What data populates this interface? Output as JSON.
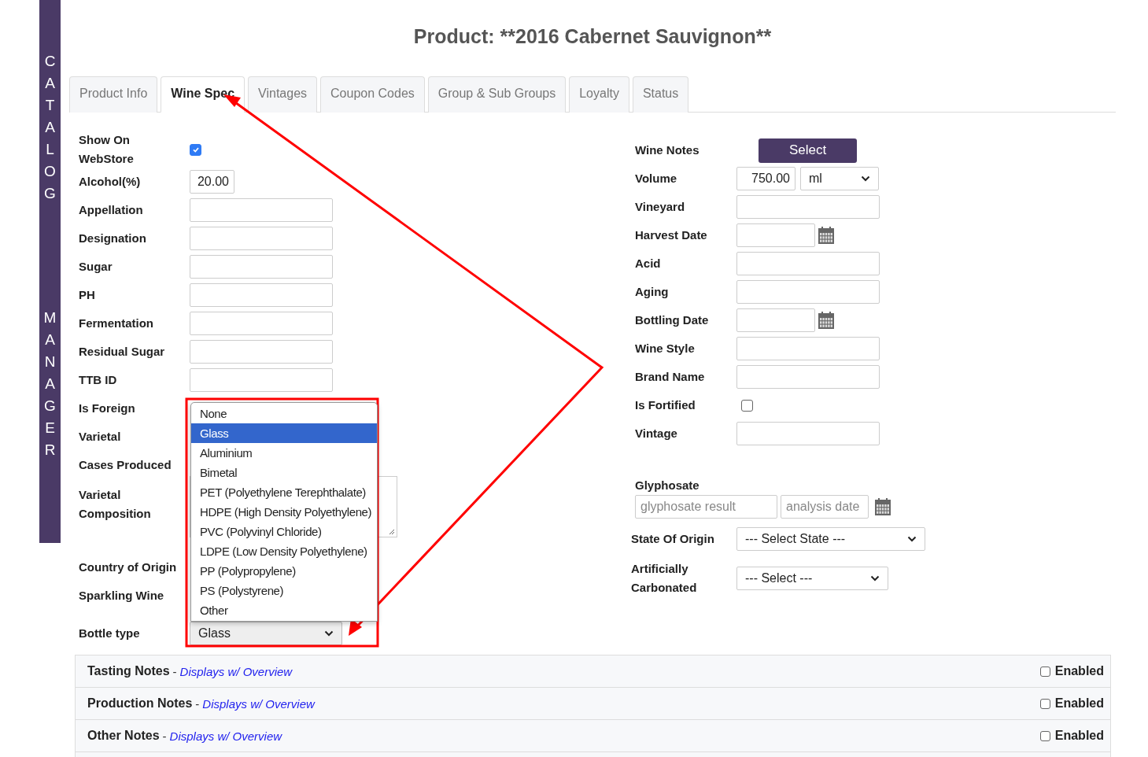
{
  "sidebar": {
    "words": [
      "CATALOG",
      "MANAGER"
    ]
  },
  "title": "Product: **2016 Cabernet Sauvignon**",
  "tabs": [
    {
      "label": "Product Info",
      "selected": false
    },
    {
      "label": "Wine Spec",
      "selected": true
    },
    {
      "label": "Vintages",
      "selected": false
    },
    {
      "label": "Coupon Codes",
      "selected": false
    },
    {
      "label": "Group & Sub Groups",
      "selected": false
    },
    {
      "label": "Loyalty",
      "selected": false
    },
    {
      "label": "Status",
      "selected": false
    }
  ],
  "left_fields": [
    {
      "label": "Show On WebStore",
      "kind": "checkbox",
      "checked": true
    },
    {
      "label": "Alcohol(%)",
      "kind": "number",
      "value": "20.00"
    },
    {
      "label": "Appellation",
      "kind": "input"
    },
    {
      "label": "Designation",
      "kind": "input"
    },
    {
      "label": "Sugar",
      "kind": "input"
    },
    {
      "label": "PH",
      "kind": "input"
    },
    {
      "label": "Fermentation",
      "kind": "input"
    },
    {
      "label": "Residual Sugar",
      "kind": "input"
    },
    {
      "label": "TTB ID",
      "kind": "input"
    },
    {
      "label": "Is Foreign",
      "kind": "label"
    },
    {
      "label": "Varietal",
      "kind": "label"
    },
    {
      "label": "Cases Produced",
      "kind": "label"
    },
    {
      "label": "Varietal Composition",
      "kind": "textarea"
    },
    {
      "label": "Country of Origin",
      "kind": "label"
    },
    {
      "label": "Sparkling Wine",
      "kind": "label"
    },
    {
      "label": "Bottle type",
      "kind": "select",
      "value": "Glass",
      "open": true,
      "options": [
        {
          "label": "None",
          "selected": false
        },
        {
          "label": "Glass",
          "selected": true
        },
        {
          "label": "Aluminium",
          "selected": false
        },
        {
          "label": "Bimetal",
          "selected": false
        },
        {
          "label": "PET (Polyethylene Terephthalate)",
          "selected": false
        },
        {
          "label": "HDPE (High Density Polyethylene)",
          "selected": false
        },
        {
          "label": "PVC (Polyvinyl Chloride)",
          "selected": false
        },
        {
          "label": "LDPE (Low Density Polyethylene)",
          "selected": false
        },
        {
          "label": "PP (Polypropylene)",
          "selected": false
        },
        {
          "label": "PS (Polystyrene)",
          "selected": false
        },
        {
          "label": "Other",
          "selected": false
        }
      ]
    }
  ],
  "right_fields": [
    {
      "label": "Wine Notes",
      "kind": "button",
      "button": "Select"
    },
    {
      "label": "Volume",
      "kind": "volume",
      "value": "750.00",
      "unit": "ml"
    },
    {
      "label": "Vineyard",
      "kind": "input"
    },
    {
      "label": "Harvest Date",
      "kind": "date"
    },
    {
      "label": "Acid",
      "kind": "input"
    },
    {
      "label": "Aging",
      "kind": "input"
    },
    {
      "label": "Bottling Date",
      "kind": "date"
    },
    {
      "label": "Wine Style",
      "kind": "input"
    },
    {
      "label": "Brand Name",
      "kind": "input"
    },
    {
      "label": "Is Fortified",
      "kind": "checkbox",
      "checked": false
    },
    {
      "label": "Vintage",
      "kind": "input"
    }
  ],
  "glyphosate": {
    "label": "Glyphosate",
    "result_placeholder": "glyphosate result",
    "date_placeholder": "analysis date"
  },
  "origin_fields": [
    {
      "label": "State Of Origin",
      "value": "--- Select State ---",
      "wide": true
    },
    {
      "label": "Artificially Carbonated",
      "value": "--- Select ---",
      "wide": false
    }
  ],
  "notes": [
    {
      "title": "Tasting Notes",
      "separator": "-",
      "hint": "Displays w/ Overview",
      "enabled": false,
      "enabled_label": "Enabled"
    },
    {
      "title": "Production Notes",
      "separator": "-",
      "hint": "Displays w/ Overview",
      "enabled": false,
      "enabled_label": "Enabled"
    },
    {
      "title": "Other Notes",
      "separator": "-",
      "hint": "Displays w/ Overview",
      "enabled": false,
      "enabled_label": "Enabled"
    }
  ]
}
